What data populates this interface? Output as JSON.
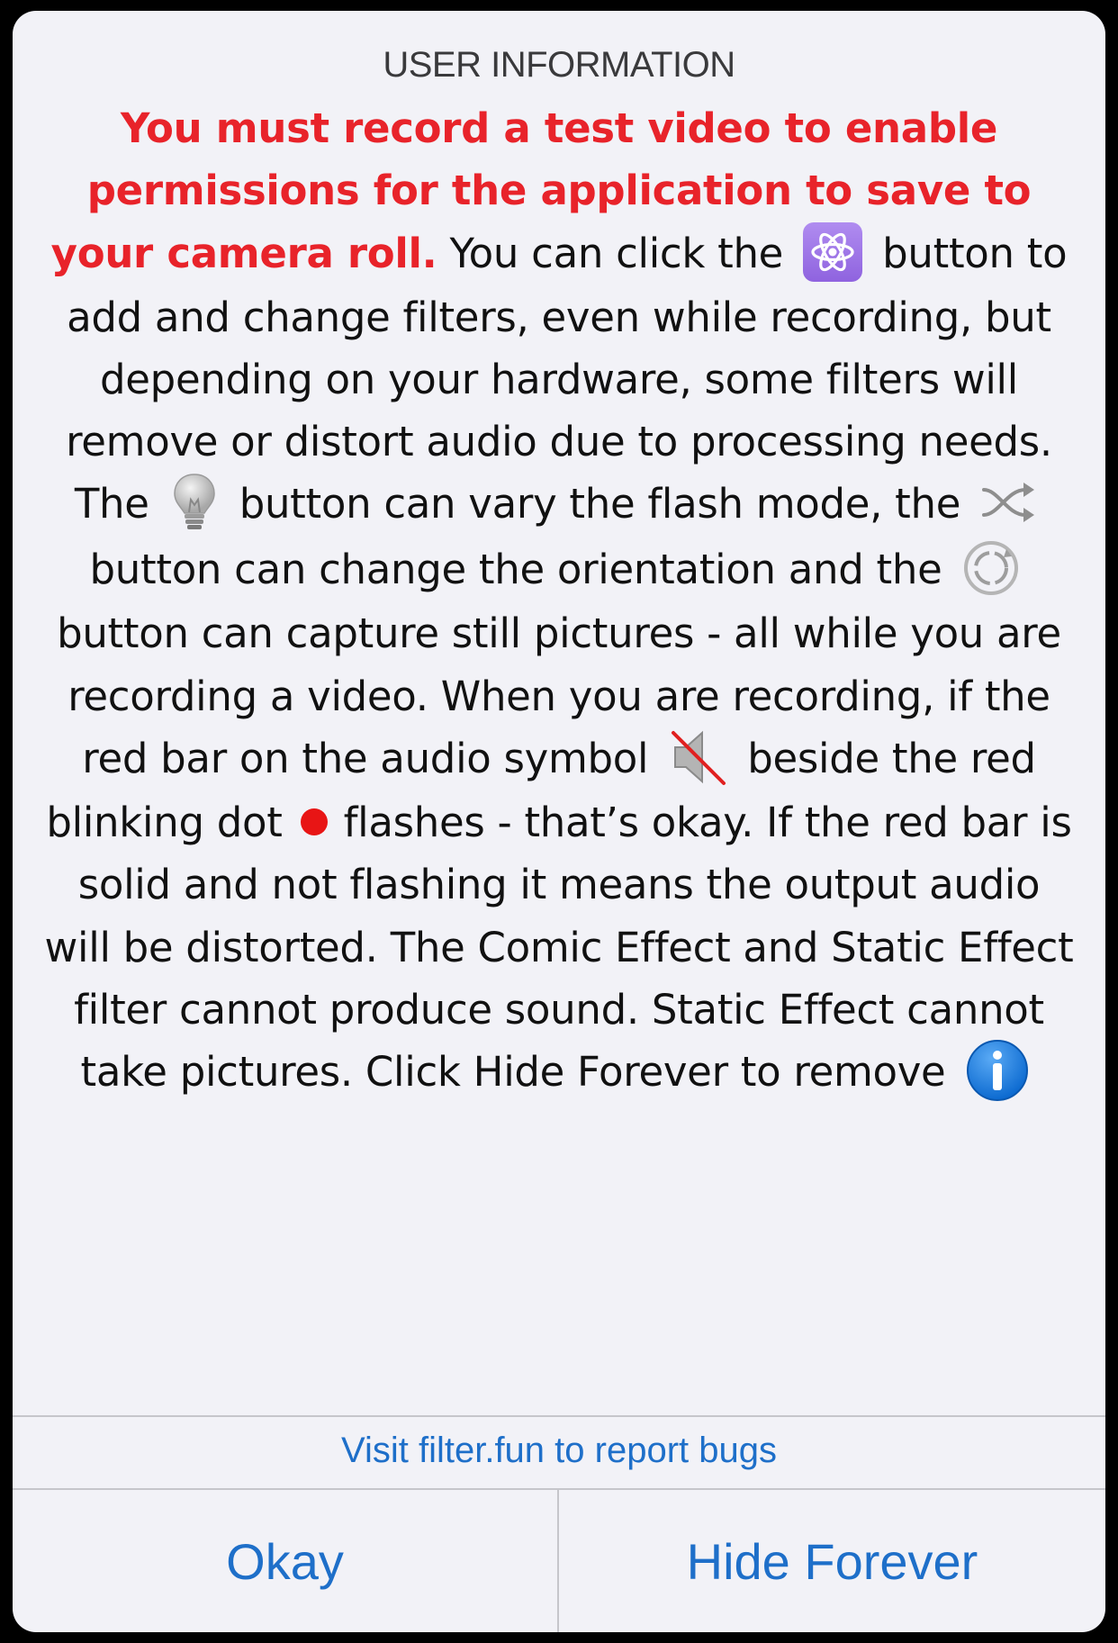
{
  "alert": {
    "title": "USER INFORMATION",
    "message": {
      "warning": "You must record a test video to enable permissions for the application to save to your camera roll.",
      "seg1": " You can click the",
      "seg2": "button to add and change filters, even while recording, but depending on your hardware, some filters will remove or distort audio due to processing needs. The",
      "seg3": "button can vary the flash mode, the",
      "seg4": "button can change the orientation and the",
      "seg5": "button can capture still pictures - all while you are recording a video. When you are recording, if the red bar on the audio symbol",
      "seg6": "beside the red blinking dot",
      "seg7": "flashes - that’s okay. If the red bar is solid and not flashing it means the output audio will be distorted. The Comic Effect and Static Effect filter cannot produce sound. Static Effect cannot take pictures. Click Hide Forever to remove"
    },
    "icons": {
      "filters": "atom-icon",
      "flash": "lightbulb-icon",
      "orientation": "shuffle-icon",
      "capture": "camera-capture-icon",
      "audio": "muted-speaker-icon",
      "recording": "red-dot-icon",
      "info": "info-icon"
    },
    "link": "Visit filter.fun to report bugs",
    "buttons": {
      "okay": "Okay",
      "hide_forever": "Hide Forever"
    },
    "colors": {
      "warning": "#e8232a",
      "link": "#1e6fc9",
      "background": "#f2f2f7",
      "filter_button": "#9b74e8",
      "record_dot": "#e81515",
      "info_blue": "#1a7ee0"
    }
  }
}
